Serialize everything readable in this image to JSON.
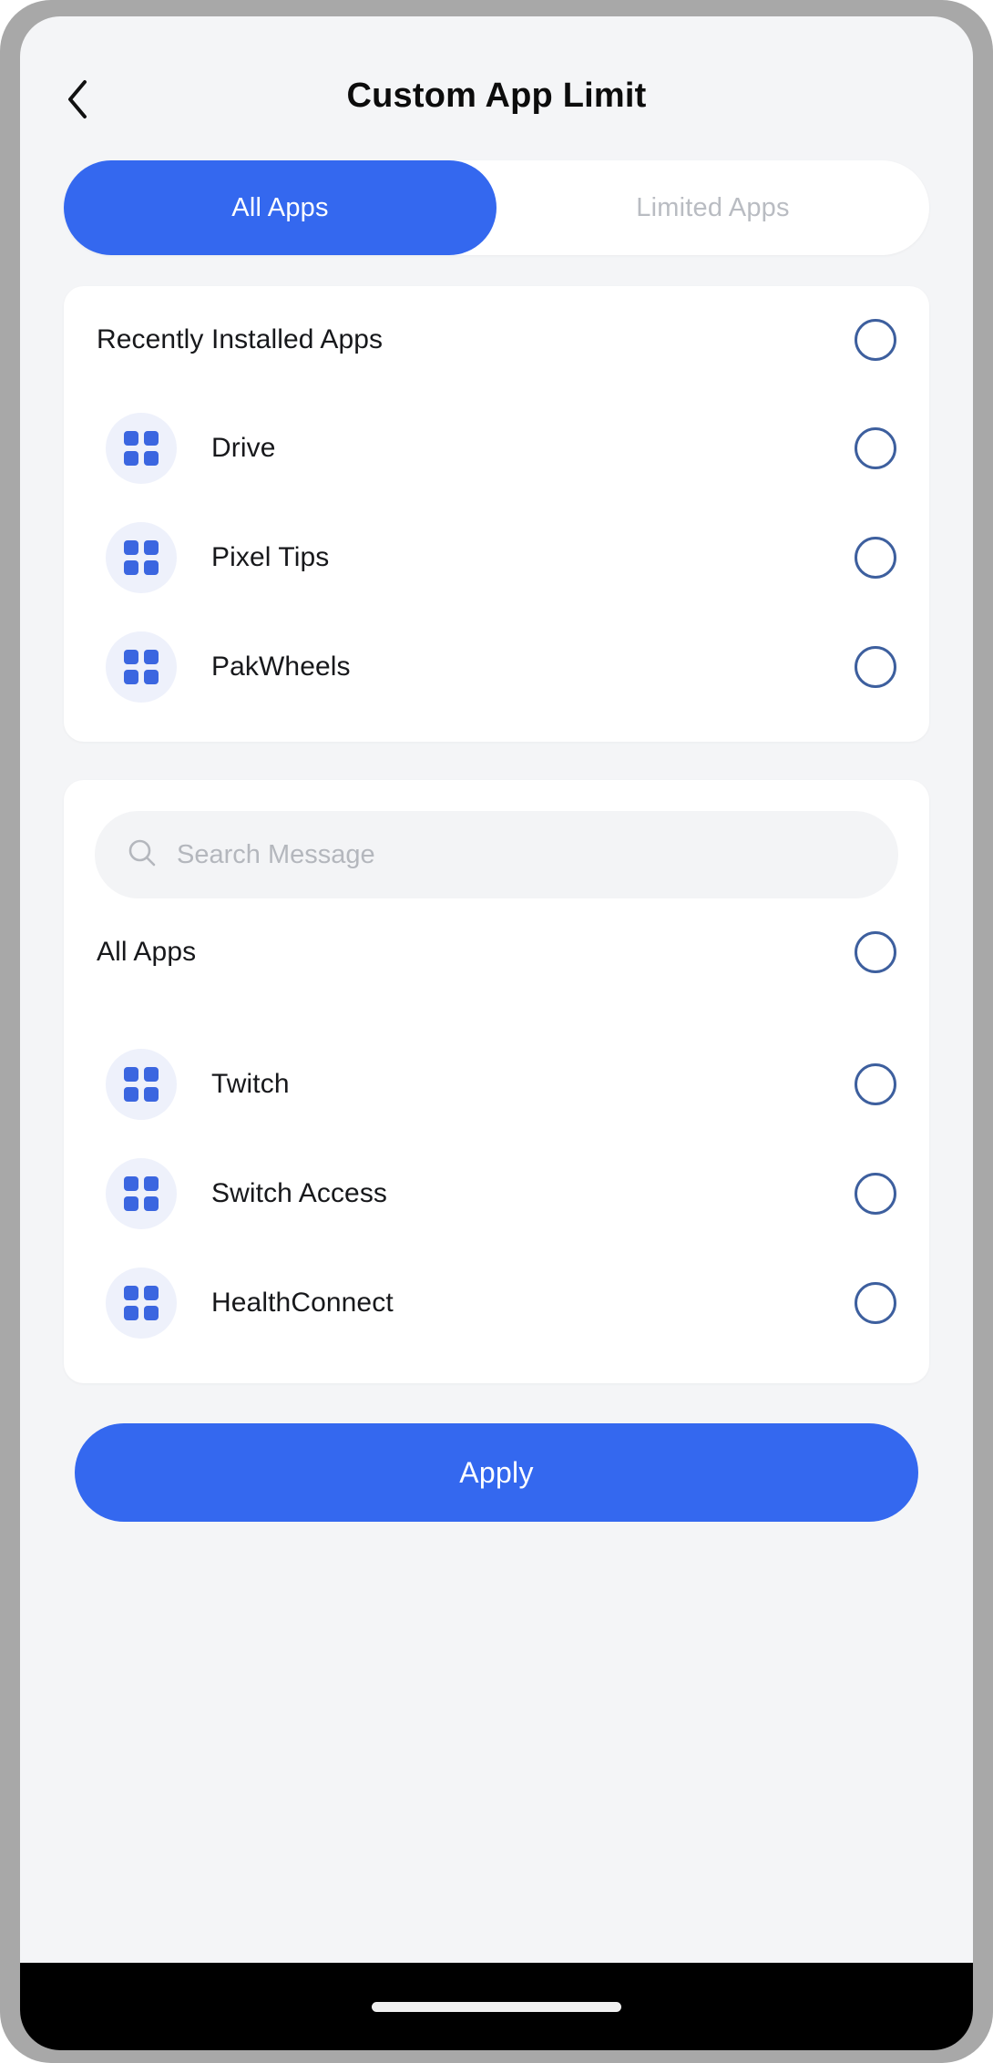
{
  "header": {
    "title": "Custom App Limit",
    "back_icon": "chevron-left-icon"
  },
  "tabs": {
    "items": [
      {
        "label": "All Apps",
        "active": true
      },
      {
        "label": "Limited Apps",
        "active": false
      }
    ]
  },
  "recently_installed_card": {
    "section_title": "Recently Installed Apps",
    "section_selected": false,
    "apps": [
      {
        "name": "Drive",
        "icon": "app-grid-icon",
        "selected": false
      },
      {
        "name": "Pixel Tips",
        "icon": "app-grid-icon",
        "selected": false
      },
      {
        "name": "PakWheels",
        "icon": "app-grid-icon",
        "selected": false
      }
    ]
  },
  "all_apps_card": {
    "search": {
      "icon": "search-icon",
      "placeholder": "Search Message",
      "value": ""
    },
    "section_title": "All Apps",
    "section_selected": false,
    "apps": [
      {
        "name": "Twitch",
        "icon": "app-grid-icon",
        "selected": false
      },
      {
        "name": "Switch Access",
        "icon": "app-grid-icon",
        "selected": false
      },
      {
        "name": "HealthConnect",
        "icon": "app-grid-icon",
        "selected": false
      }
    ]
  },
  "footer": {
    "apply_label": "Apply"
  },
  "colors": {
    "accent": "#3468ef",
    "radio_outline": "#3d5f9e",
    "app_icon_bg": "#eef1fb",
    "app_icon_fg": "#3b66e0",
    "page_bg": "#f4f5f7",
    "card_bg": "#ffffff",
    "search_bg": "#f3f4f6",
    "tab_inactive_text": "#b9bcc2",
    "title_text": "#0c0c0c",
    "nav_bar": "#000000",
    "frame": "#a8a8a8"
  }
}
